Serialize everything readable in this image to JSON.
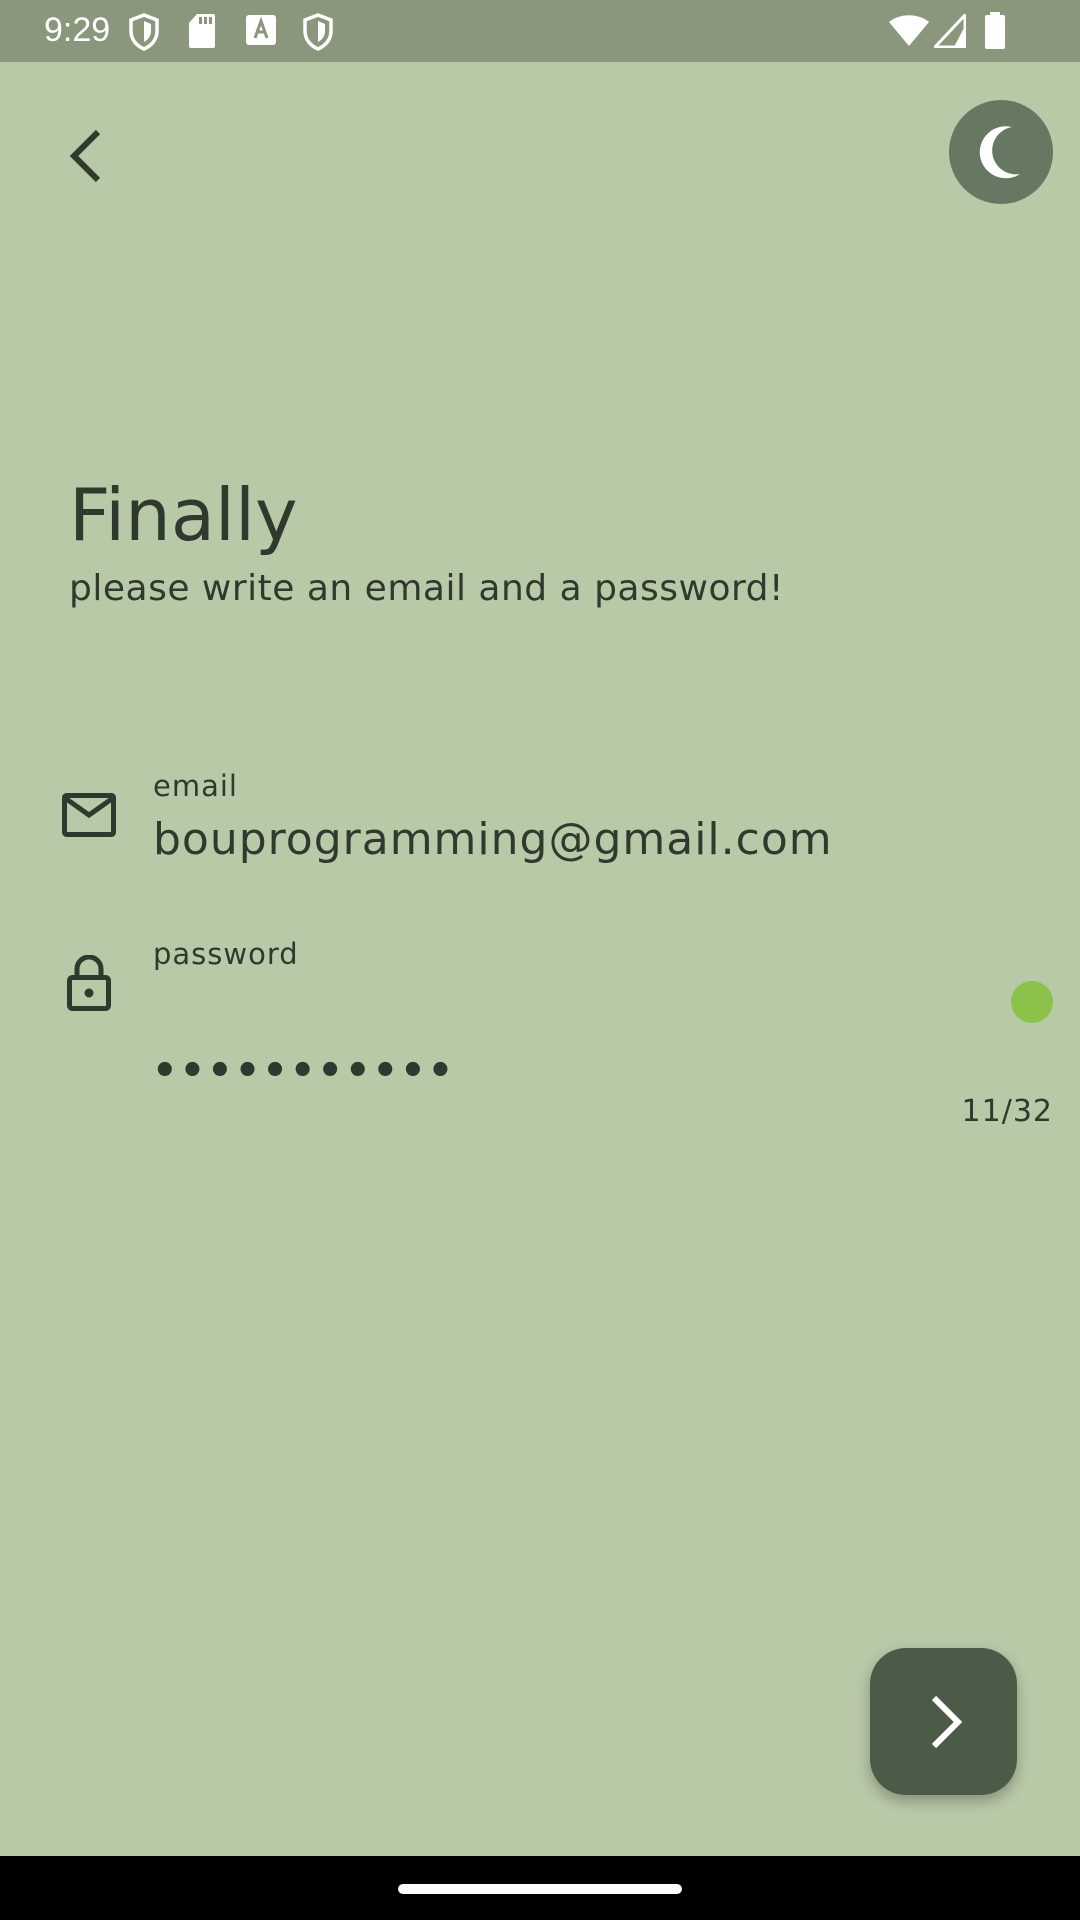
{
  "status_bar": {
    "time": "9:29",
    "left_icons": [
      "shield-icon",
      "sd-card-icon",
      "font-download-icon",
      "shield-icon"
    ],
    "right_icons": [
      "wifi-icon",
      "signal-icon",
      "battery-icon"
    ]
  },
  "header": {
    "back_icon": "chevron-left-icon",
    "theme_icon": "moon-icon"
  },
  "main": {
    "title": "Finally",
    "subtitle": "please write an email and a password!"
  },
  "email_field": {
    "icon": "mail-icon",
    "label": "email",
    "value": "bouprogramming@gmail.com"
  },
  "password_field": {
    "icon": "lock-icon",
    "label": "password",
    "masked_value": "•••••••••••",
    "counter": "11/32",
    "strength_color": "#8bc34a"
  },
  "fab": {
    "icon": "chevron-right-icon"
  },
  "colors": {
    "background": "#b8c9a8",
    "status_bar": "#8a977c",
    "theme_button": "#667862",
    "fab": "#4c5a48",
    "text": "#2f3a2e"
  }
}
